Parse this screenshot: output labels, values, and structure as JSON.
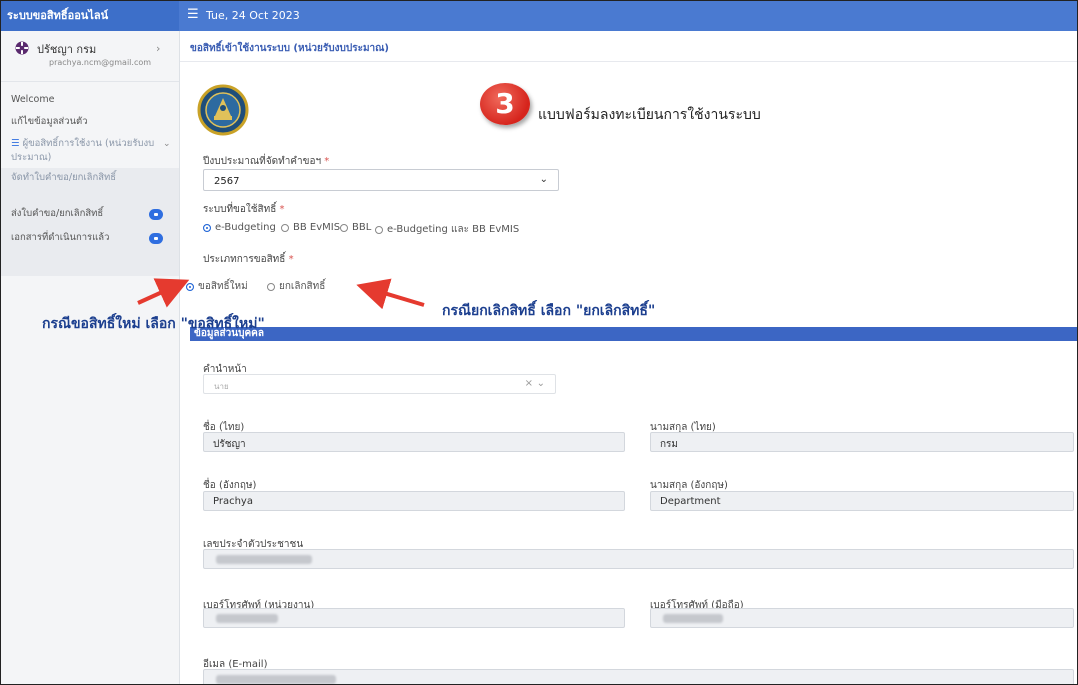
{
  "app": {
    "brand": "ระบบขอสิทธิ์ออนไลน์",
    "date": "Tue, 24 Oct 2023",
    "accent": "#4a7ad1"
  },
  "user": {
    "name": "ปรัชญา กรม",
    "email": "prachya.ncm@gmail.com"
  },
  "sidebar": {
    "items": [
      {
        "label": "Welcome",
        "icon": ""
      },
      {
        "label": "แก้ไขข้อมูลส่วนตัว",
        "icon": ""
      },
      {
        "label": "ผู้ขอสิทธิ์การใช้งาน (หน่วยรับงบประมาณ)",
        "icon": "list-icon"
      },
      {
        "label": "จัดทำใบคำขอ/ยกเลิกสิทธิ์",
        "icon": ""
      },
      {
        "label": "ส่งใบคำขอ/ยกเลิกสิทธิ์",
        "icon": "badge"
      },
      {
        "label": "เอกสารที่ดำเนินการแล้ว",
        "icon": "badge"
      }
    ]
  },
  "main": {
    "breadcrumb": "ขอสิทธิ์เข้าใช้งานระบบ (หน่วยรับงบประมาณ)",
    "step_number": "3",
    "form_title": "แบบฟอร์มลงทะเบียนการใช้งานระบบ",
    "fiscal_year": {
      "label": "ปีงบประมาณที่จัดทำคำขอฯ",
      "required": "*",
      "value": "2567"
    },
    "system": {
      "label": "ระบบที่ขอใช้สิทธิ์",
      "required": "*",
      "options": [
        "e-Budgeting",
        "BB EvMIS",
        "BBL",
        "e-Budgeting และ BB EvMIS"
      ],
      "selected": "e-Budgeting"
    },
    "request_type": {
      "label": "ประเภทการขอสิทธิ์",
      "required": "*",
      "options": [
        "ขอสิทธิ์ใหม่",
        "ยกเลิกสิทธิ์"
      ],
      "selected": "ขอสิทธิ์ใหม่"
    },
    "personal": {
      "section_title": "ข้อมูลส่วนบุคคล",
      "prefix_label": "คำนำหน้า",
      "prefix_value": "นาย",
      "prefix_clear": "×",
      "first_name_th_label": "ชื่อ (ไทย)",
      "first_name_th": "ปรัชญา",
      "last_name_th_label": "นามสกุล (ไทย)",
      "last_name_th": "กรม",
      "first_name_en_label": "ชื่อ (อังกฤษ)",
      "first_name_en": "Prachya",
      "last_name_en_label": "นามสกุล (อังกฤษ)",
      "last_name_en": "Department",
      "citizen_id_label": "เลขประจำตัวประชาชน",
      "phone_office_label": "เบอร์โทรศัพท์ (หน่วยงาน)",
      "phone_mobile_label": "เบอร์โทรศัพท์ (มือถือ)",
      "email_label": "อีเมล (E-mail)"
    }
  },
  "annotations": {
    "left": "กรณีขอสิทธิ์ใหม่ เลือก \"ขอสิทธิ์ใหม่\"",
    "right": "กรณียกเลิกสิทธิ์ เลือก \"ยกเลิกสิทธิ์\"",
    "arrow_color": "#e53a2f",
    "text_color": "#1c3f8f"
  }
}
